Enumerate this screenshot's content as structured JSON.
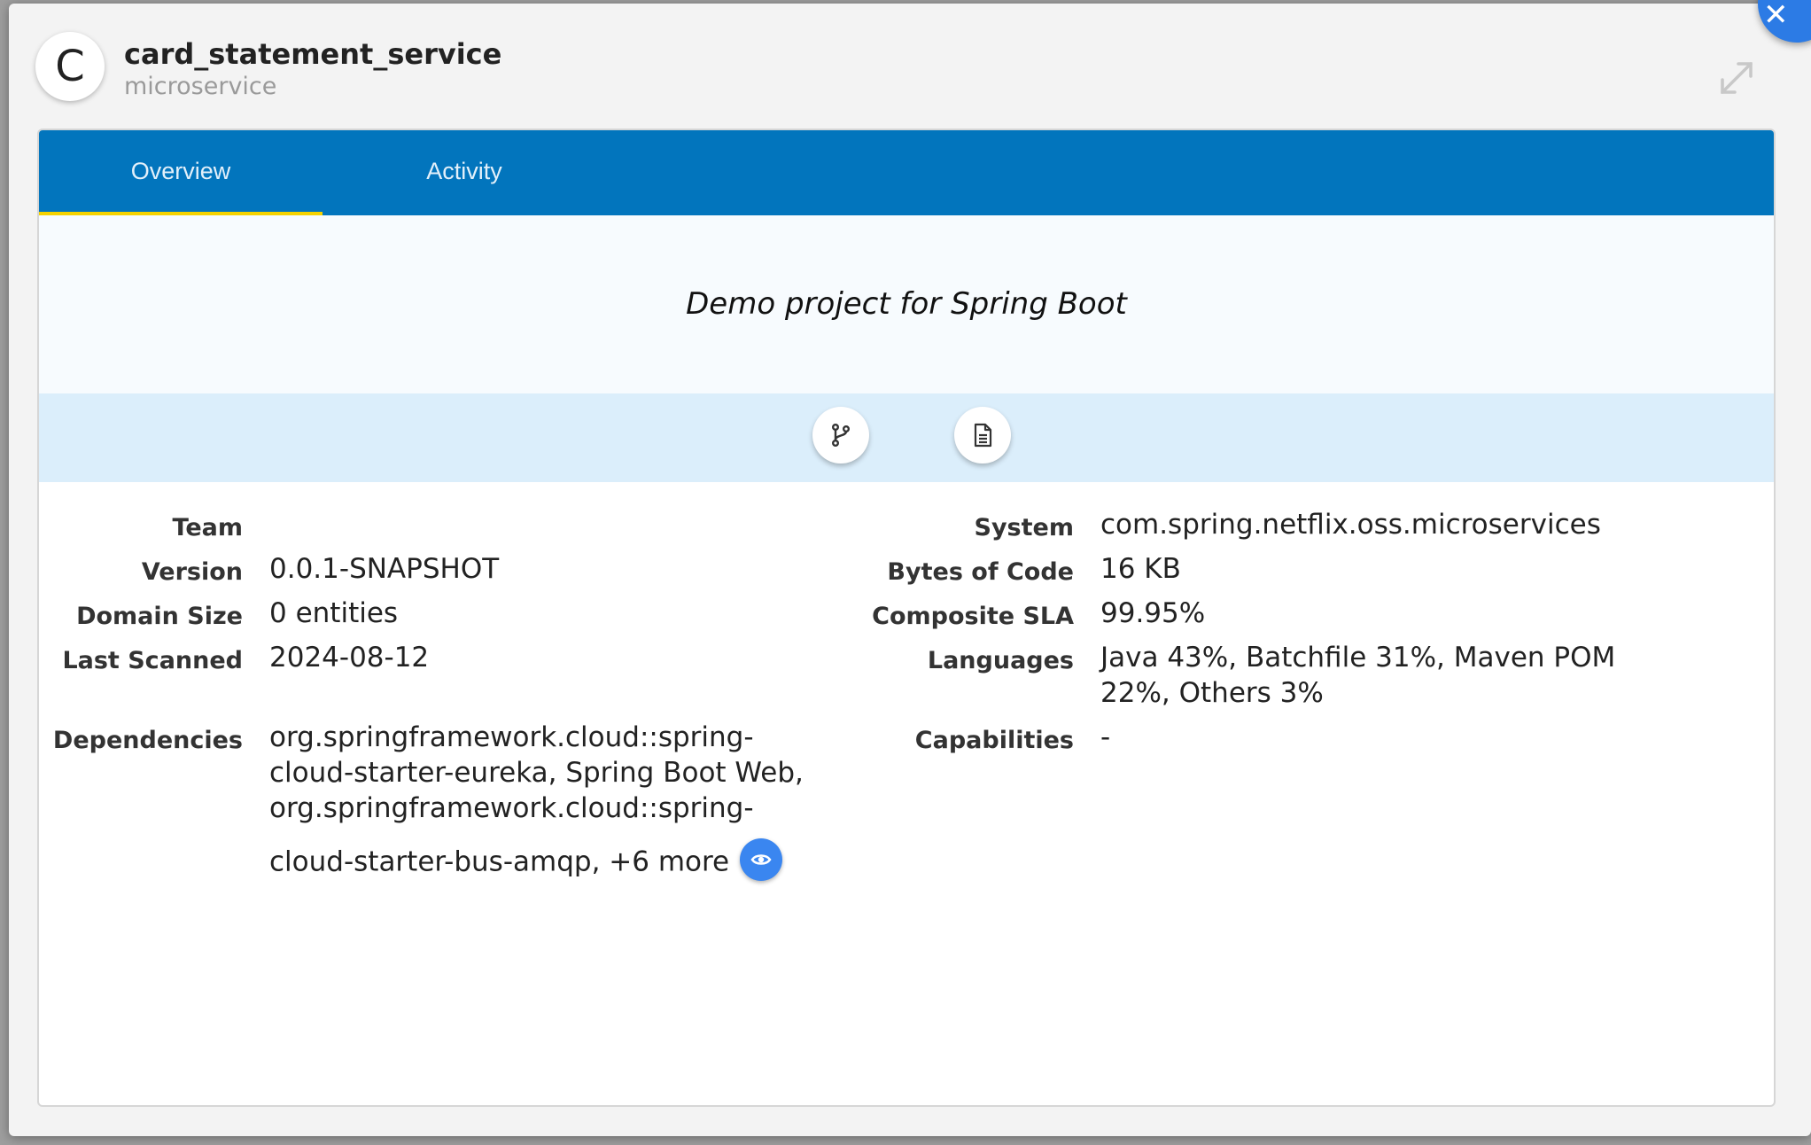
{
  "header": {
    "avatar_letter": "C",
    "title": "card_statement_service",
    "subtitle": "microservice"
  },
  "tabs": [
    {
      "label": "Overview",
      "active": true
    },
    {
      "label": "Activity",
      "active": false
    }
  ],
  "description": "Demo project for Spring Boot",
  "actions": [
    {
      "icon": "git-branch-icon"
    },
    {
      "icon": "document-icon"
    }
  ],
  "details_left": [
    {
      "label": "Team",
      "value": ""
    },
    {
      "label": "Version",
      "value": "0.0.1-SNAPSHOT"
    },
    {
      "label": "Domain Size",
      "value": "0 entities"
    },
    {
      "label": "Last Scanned",
      "value": "2024-08-12"
    },
    {
      "label": "Dependencies",
      "value": "org.springframework.cloud::spring-cloud-starter-eureka, Spring Boot Web, org.springframework.cloud::spring-cloud-starter-bus-amqp, +6 more"
    }
  ],
  "dependencies_lines": [
    "org.springframework.cloud::spring-",
    "cloud-starter-eureka, Spring Boot Web,",
    "org.springframework.cloud::spring-",
    "cloud-starter-bus-amqp, +6 more"
  ],
  "details_right": [
    {
      "label": "System",
      "value": "com.spring.netflix.oss.microservices"
    },
    {
      "label": "Bytes of Code",
      "value": "16 KB"
    },
    {
      "label": "Composite SLA",
      "value": "99.95%"
    },
    {
      "label": "Languages",
      "value": "Java 43%, Batchfile 31%, Maven POM 22%, Others 3%"
    },
    {
      "label": "Capabilities",
      "value": "-"
    }
  ],
  "languages_lines": [
    "Java 43%, Batchfile 31%, Maven POM",
    "22%, Others 3%"
  ],
  "colors": {
    "tab_bar": "#0275bd",
    "tab_indicator": "#f5d200",
    "action_band": "#dbeefb",
    "eye_button": "#3a86f0",
    "close_button": "#2c7be5"
  }
}
